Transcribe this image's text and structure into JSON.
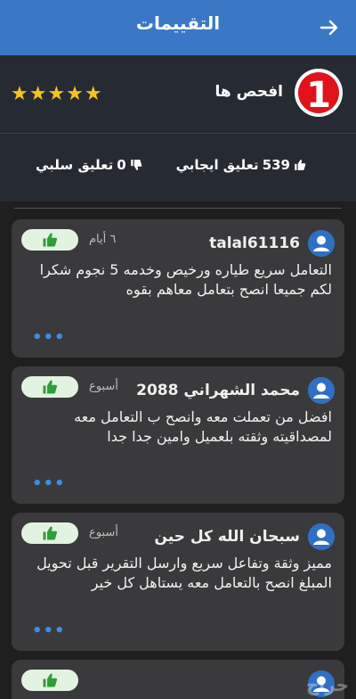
{
  "header": {
    "title": "التقييمات"
  },
  "summary": {
    "seller_name": "افحص ها",
    "rank_number": "1",
    "stars": "★★★★★",
    "positive_count": "539",
    "positive_label": "تعليق ايجابي",
    "negative_count": "0",
    "negative_label": "تعليق سلبي"
  },
  "reviews": [
    {
      "user": "talal61116",
      "time": "٦ أيام",
      "text": "التعامل سريع طياره ورخيص وخدمه 5 نجوم شكرا لكم جميعا انصح بتعامل معاهم بقوه",
      "more": "•••"
    },
    {
      "user": "محمد الشهراني 2088",
      "time": "أسبوع",
      "text": "افضل من تعملت معه وانصح ب التعامل معه لمصداقيته وثقته بلعميل وامين جدا جدا",
      "more": "•••"
    },
    {
      "user": "سبحان الله كل حين",
      "time": "أسبوع",
      "text": "مميز وثقة وتفاعل سريع وارسل التقرير قبل تحويل المبلغ انصح بالتعامل معه يستاهل كل خير",
      "more": "•••"
    }
  ],
  "watermark": "حراج",
  "colors": {
    "header": "#3a78c6",
    "summary": "#262a33",
    "card": "#3a3a3c",
    "star": "#f6c31c",
    "like": "#2e9e36",
    "link": "#3a8ee6"
  }
}
